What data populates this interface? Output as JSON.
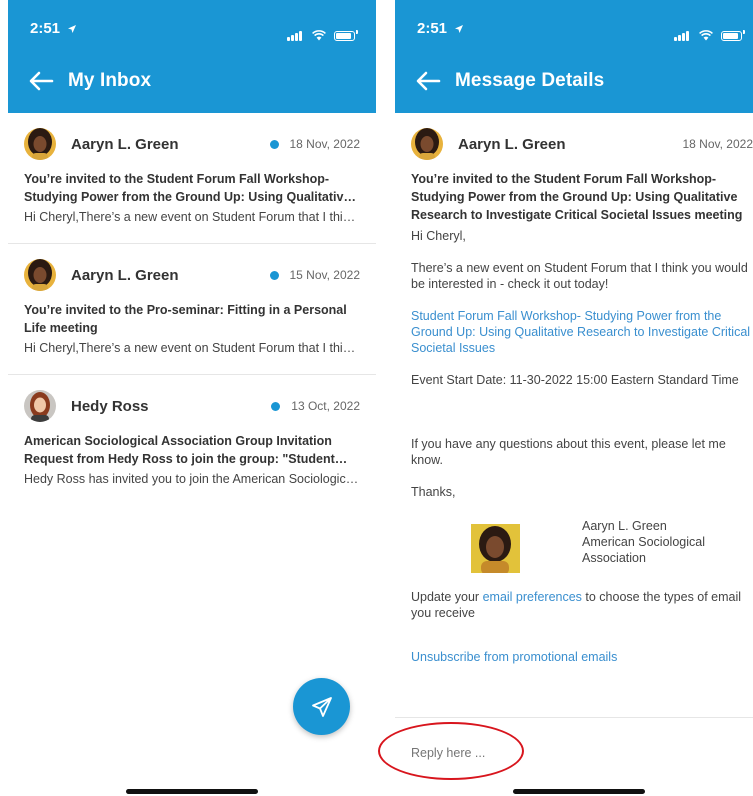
{
  "status": {
    "time": "2:51"
  },
  "inbox": {
    "title": "My Inbox",
    "messages": [
      {
        "sender": "Aaryn L. Green",
        "date": "18 Nov, 2022",
        "subject": "You’re invited to the Student Forum Fall Workshop- Studying Power from the Ground Up: Using Qualitative Research to Investigate Critical Societal Issues meeting",
        "preview": "Hi Cheryl,There’s a new event on Student Forum that I think you would be interested in"
      },
      {
        "sender": "Aaryn L. Green",
        "date": "15 Nov, 2022",
        "subject": "You’re invited to the Pro-seminar: Fitting in a Personal Life meeting",
        "preview": "Hi Cheryl,There’s a new event on Student Forum that I think you would be interested in"
      },
      {
        "sender": "Hedy Ross",
        "date": "13 Oct, 2022",
        "subject": "American Sociological Association Group Invitation Request from Hedy Ross to join the group: \"Student Forum\"",
        "preview": "Hedy Ross has invited you to join the American Sociological Association group"
      }
    ]
  },
  "details": {
    "title": "Message Details",
    "sender": "Aaryn L. Green",
    "date": "18 Nov, 2022",
    "subject": "You’re invited to the Student Forum Fall Workshop- Studying Power from the Ground Up: Using Qualitative Research to Investigate Critical Societal Issues meeting",
    "greeting": "Hi Cheryl,",
    "intro": "There’s a new event on Student Forum that I think you would be interested in - check it out today!",
    "event_link": "Student Forum Fall Workshop- Studying Power from the Ground Up: Using Qualitative Research to Investigate Critical Societal Issues",
    "start_date": "Event Start Date: 11-30-2022 15:00 Eastern Standard Time",
    "questions": "If you have any questions about this event, please let me know.",
    "thanks": "Thanks,",
    "signature_name": "Aaryn L. Green",
    "signature_org": "American Sociological Association",
    "update_prefix": "Update your ",
    "update_link": "email preferences",
    "update_suffix": " to choose the types of email you receive",
    "unsubscribe": "Unsubscribe from promotional emails",
    "reply_placeholder": "Reply here ..."
  },
  "colors": {
    "primary": "#1a96d4",
    "link": "#3a8fcf",
    "annotation": "#d8151d"
  },
  "icons": [
    "location-arrow-icon",
    "signal-icon",
    "wifi-icon",
    "battery-icon",
    "back-arrow-icon",
    "send-icon"
  ]
}
